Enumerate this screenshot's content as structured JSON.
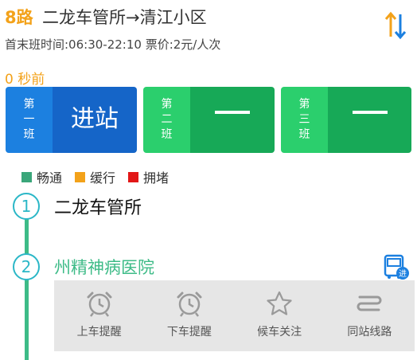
{
  "route": {
    "number": "8路",
    "name": "二龙车管所→清江小区",
    "schedule": "首末班时间:06:30-22:10 票价:2元/人次"
  },
  "updated": "0 秒前",
  "buses": [
    {
      "label": [
        "第",
        "一",
        "班"
      ],
      "value": "进站"
    },
    {
      "label": [
        "第",
        "二",
        "班"
      ],
      "value": "——"
    },
    {
      "label": [
        "第",
        "三",
        "班"
      ],
      "value": "——"
    }
  ],
  "legend": [
    {
      "label": "畅通",
      "color": "#3aa67a"
    },
    {
      "label": "缓行",
      "color": "#f3a21a"
    },
    {
      "label": "拥堵",
      "color": "#e21717"
    }
  ],
  "stops": [
    {
      "index": "1",
      "name": "二龙车管所"
    },
    {
      "index": "2",
      "name": "州精神病医院"
    }
  ],
  "bus_badge": "进",
  "actions": [
    {
      "label": "上车提醒",
      "icon": "alarm-clock-icon"
    },
    {
      "label": "下车提醒",
      "icon": "alarm-clock-icon"
    },
    {
      "label": "候车关注",
      "icon": "star-icon"
    },
    {
      "label": "同站线路",
      "icon": "route-icon"
    }
  ]
}
